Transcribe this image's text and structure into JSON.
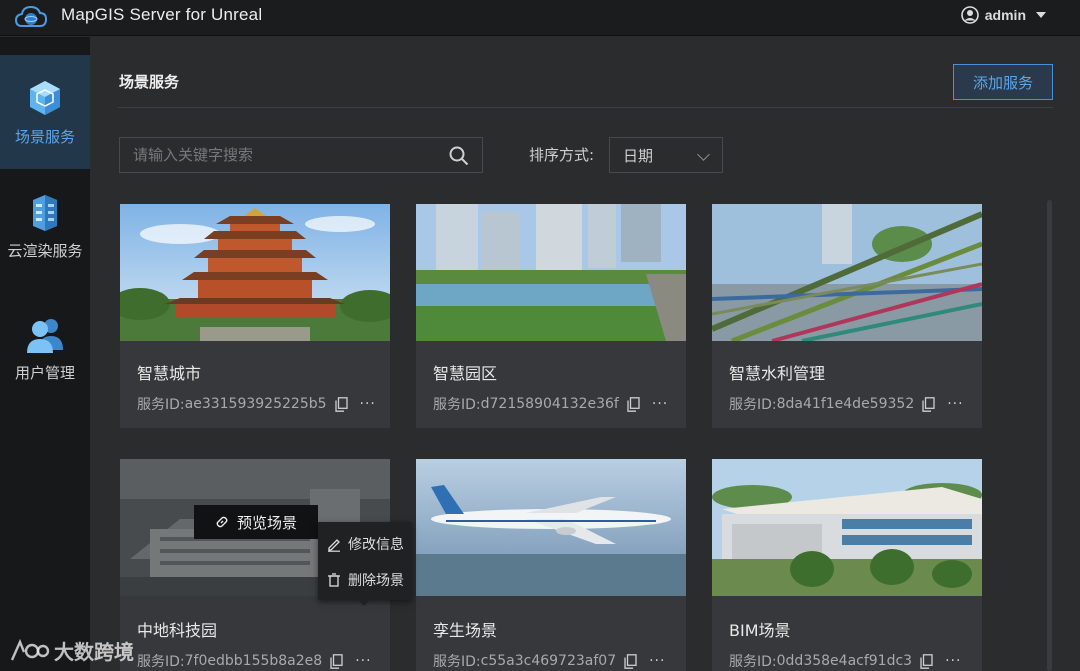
{
  "app": {
    "title": "MapGIS Server for Unreal"
  },
  "user": {
    "name": "admin"
  },
  "sidebar": {
    "items": [
      {
        "label": "场景服务",
        "active": true
      },
      {
        "label": "云渲染服务",
        "active": false
      },
      {
        "label": "用户管理",
        "active": false
      }
    ]
  },
  "page": {
    "title": "场景服务",
    "add_button": "添加服务"
  },
  "search": {
    "placeholder": "请输入关键字搜索"
  },
  "sort": {
    "label": "排序方式:",
    "value": "日期"
  },
  "cards": [
    {
      "name": "智慧城市",
      "id_label": "服务ID:",
      "id": "ae331593925225b5"
    },
    {
      "name": "智慧园区",
      "id_label": "服务ID:",
      "id": "d72158904132e36f"
    },
    {
      "name": "智慧水利管理",
      "id_label": "服务ID:",
      "id": "8da41f1e4de59352"
    },
    {
      "name": "中地科技园",
      "id_label": "服务ID:",
      "id": "7f0edbb155b8a2e8"
    },
    {
      "name": "孪生场景",
      "id_label": "服务ID:",
      "id": "c55a3c469723af07"
    },
    {
      "name": "BIM场景",
      "id_label": "服务ID:",
      "id": "0dd358e4acf91dc3"
    }
  ],
  "hover": {
    "preview_label": "预览场景"
  },
  "menu": {
    "edit_label": "修改信息",
    "delete_label": "删除场景"
  },
  "watermark": {
    "text": "大数跨境"
  },
  "colors": {
    "accent": "#4a90d8",
    "active_bg": "#22374a",
    "background": "#2b2c2e"
  }
}
